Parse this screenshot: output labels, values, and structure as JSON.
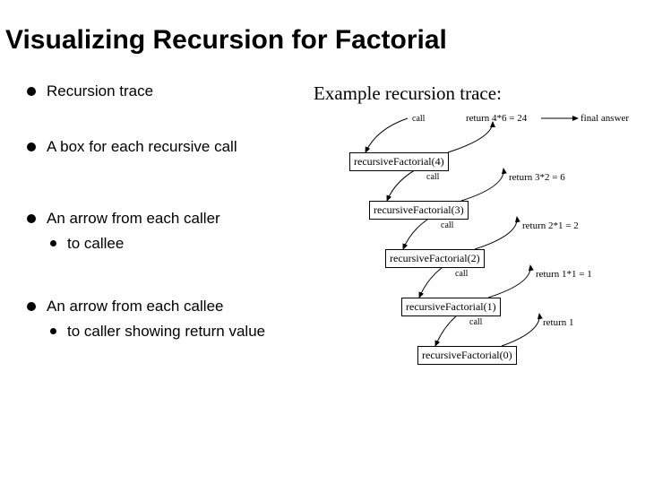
{
  "title": "Visualizing Recursion for Factorial",
  "bullets": {
    "b1": "Recursion trace",
    "b2": "A box for each recursive call",
    "b3": "An arrow from each caller",
    "b3sub": "to callee",
    "b4": "An arrow from each callee",
    "b4sub": "to caller showing return value"
  },
  "example_title": "Example recursion trace:",
  "diagram": {
    "boxes": {
      "n4": "recursiveFactorial(4)",
      "n3": "recursiveFactorial(3)",
      "n2": "recursiveFactorial(2)",
      "n1": "recursiveFactorial(1)",
      "n0": "recursiveFactorial(0)"
    },
    "call_label": "call",
    "returns": {
      "r4": "return 4*6 = 24",
      "r3": "return 3*2 = 6",
      "r2": "return 2*1 = 2",
      "r1": "return 1*1 = 1",
      "r0": "return 1"
    },
    "final": "final answer"
  },
  "chart_data": {
    "type": "table",
    "title": "Recursive factorial trace",
    "columns": [
      "call",
      "returns"
    ],
    "rows": [
      {
        "call": "recursiveFactorial(4)",
        "returns": "4*6 = 24"
      },
      {
        "call": "recursiveFactorial(3)",
        "returns": "3*2 = 6"
      },
      {
        "call": "recursiveFactorial(2)",
        "returns": "2*1 = 2"
      },
      {
        "call": "recursiveFactorial(1)",
        "returns": "1*1 = 1"
      },
      {
        "call": "recursiveFactorial(0)",
        "returns": "1"
      }
    ],
    "final_answer": 24
  }
}
